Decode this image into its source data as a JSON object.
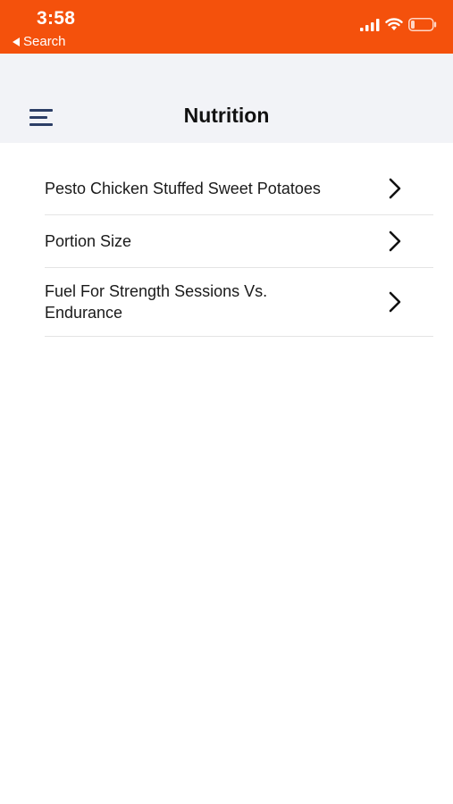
{
  "status_bar": {
    "time": "3:58",
    "back_label": "Search",
    "background_color": "#f4510c"
  },
  "nav": {
    "title": "Nutrition",
    "menu_icon": "hamburger-menu-icon"
  },
  "items": [
    {
      "label": "Pesto Chicken Stuffed Sweet Potatoes",
      "icon": "chevron-right-icon"
    },
    {
      "label": "Portion Size",
      "icon": "chevron-right-icon"
    },
    {
      "label": "Fuel For Strength Sessions Vs. Endurance",
      "icon": "chevron-right-icon"
    }
  ]
}
